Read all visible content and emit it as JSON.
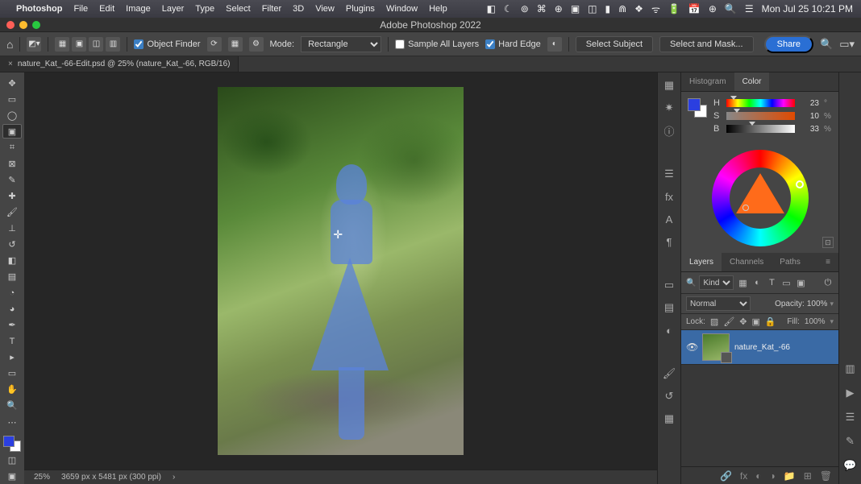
{
  "menubar": {
    "app": "Photoshop",
    "items": [
      "File",
      "Edit",
      "Image",
      "Layer",
      "Type",
      "Select",
      "Filter",
      "3D",
      "View",
      "Plugins",
      "Window",
      "Help"
    ],
    "clock": "Mon Jul 25  10:21 PM"
  },
  "window_title": "Adobe Photoshop 2022",
  "options": {
    "object_finder": "Object Finder",
    "mode_label": "Mode:",
    "mode_value": "Rectangle",
    "sample_all": "Sample All Layers",
    "hard_edge": "Hard Edge",
    "select_subject": "Select Subject",
    "select_and_mask": "Select and Mask...",
    "share": "Share"
  },
  "tab": {
    "label": "nature_Kat_-66-Edit.psd @ 25% (nature_Kat_-66, RGB/16)"
  },
  "status": {
    "zoom": "25%",
    "dims": "3659 px x 5481 px (300 ppi)"
  },
  "panels": {
    "top_tabs": {
      "histogram": "Histogram",
      "color": "Color"
    },
    "hsb": {
      "h": {
        "label": "H",
        "value": "23",
        "unit": "°"
      },
      "s": {
        "label": "S",
        "value": "10",
        "unit": "%"
      },
      "b": {
        "label": "B",
        "value": "33",
        "unit": "%"
      }
    },
    "layers_tabs": {
      "layers": "Layers",
      "channels": "Channels",
      "paths": "Paths"
    },
    "kind_label": "Kind",
    "blend": {
      "mode": "Normal",
      "opacity_label": "Opacity:",
      "opacity": "100%",
      "fill_label": "Fill:",
      "fill": "100%"
    },
    "lock_label": "Lock:",
    "layer_name": "nature_Kat_-66"
  },
  "colors": {
    "foreground": "#2b3fe0",
    "background": "#ffffff"
  }
}
